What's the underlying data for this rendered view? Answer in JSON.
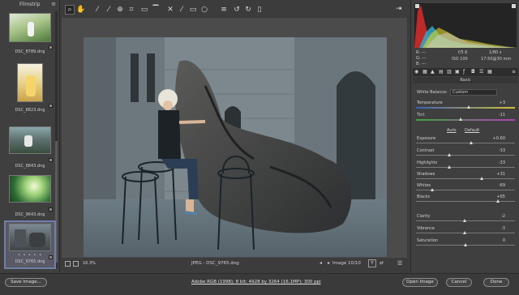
{
  "filmstrip": {
    "title": "Filmstrip",
    "items": [
      {
        "name": "DSC_8789.dng"
      },
      {
        "name": "DSC_8823.dng"
      },
      {
        "name": "DSC_8843.dng"
      },
      {
        "name": "DSC_9643.dng"
      },
      {
        "name": "DSC_9765.dng",
        "selected": true,
        "stars": "• • • • •"
      }
    ]
  },
  "toolbar": {
    "tools": [
      "zoom-icon",
      "hand-icon",
      "white-balance-icon",
      "color-sampler-icon",
      "target-adjust-icon",
      "crop-icon",
      "straighten-icon",
      "spot-removal-icon",
      "red-eye-icon",
      "adjustment-brush-icon",
      "graduated-filter-icon",
      "radial-filter-icon",
      "preferences-icon",
      "rotate-ccw-icon",
      "rotate-cw-icon",
      "trash-icon"
    ]
  },
  "preview": {
    "zoom": "16.3%",
    "filename": "JPEG - DSC_9765.dng",
    "image_count": "Image 10/10",
    "y_label": "Y"
  },
  "readout": {
    "r": "R:  ---",
    "g": "G:  ---",
    "b": "B:  ---",
    "aperture": "f/5.6",
    "shutter": "1/80 s",
    "iso": "ISO 100",
    "lens": "17-50@30 mm"
  },
  "panel": {
    "section": "Basic",
    "white_balance_label": "White Balance:",
    "white_balance_value": "Custom",
    "auto": "Auto",
    "default": "Default",
    "sliders": [
      {
        "label": "Temperature",
        "value": "+3",
        "pos": 0.53
      },
      {
        "label": "Tint",
        "value": "-11",
        "pos": 0.45
      },
      {
        "label": "Exposure",
        "value": "+0.60",
        "pos": 0.56
      },
      {
        "label": "Contrast",
        "value": "-33",
        "pos": 0.34
      },
      {
        "label": "Highlights",
        "value": "-33",
        "pos": 0.34
      },
      {
        "label": "Shadows",
        "value": "+31",
        "pos": 0.66
      },
      {
        "label": "Whites",
        "value": "-69",
        "pos": 0.16
      },
      {
        "label": "Blacks",
        "value": "+65",
        "pos": 0.83
      },
      {
        "label": "Clarity",
        "value": "-2",
        "pos": 0.49
      },
      {
        "label": "Vibrance",
        "value": "-3",
        "pos": 0.49
      },
      {
        "label": "Saturation",
        "value": "0",
        "pos": 0.5
      }
    ]
  },
  "bottom": {
    "save": "Save Image...",
    "info": "Adobe RGB (1998); 8 bit; 4928 by 3264 (16.1MP); 300 ppi",
    "open": "Open Image",
    "cancel": "Cancel",
    "done": "Done"
  },
  "colors": {
    "selected_outline": "#6f7fa6",
    "panel_bg": "#3f3f3f",
    "preview_bg": "#4b4b4b"
  }
}
